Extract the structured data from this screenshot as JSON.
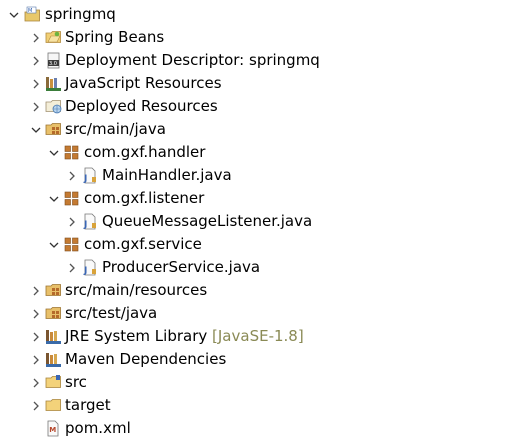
{
  "tree": {
    "project": {
      "label": "springmq",
      "icon": "maven-project-icon"
    },
    "items": [
      {
        "label": "Spring Beans",
        "icon": "spring-beans-folder-icon"
      },
      {
        "label": "Deployment Descriptor: springmq",
        "icon": "deployment-descriptor-icon"
      },
      {
        "label": "JavaScript Resources",
        "icon": "javascript-resources-icon"
      },
      {
        "label": "Deployed Resources",
        "icon": "deployed-resources-icon"
      },
      {
        "label": "src/main/java",
        "icon": "source-folder-icon"
      },
      {
        "label": "com.gxf.handler",
        "icon": "package-icon"
      },
      {
        "label": "MainHandler.java",
        "icon": "java-file-icon"
      },
      {
        "label": "com.gxf.listener",
        "icon": "package-icon"
      },
      {
        "label": "QueueMessageListener.java",
        "icon": "java-file-icon"
      },
      {
        "label": "com.gxf.service",
        "icon": "package-icon"
      },
      {
        "label": "ProducerService.java",
        "icon": "java-file-icon"
      },
      {
        "label": "src/main/resources",
        "icon": "source-folder-icon"
      },
      {
        "label": "src/test/java",
        "icon": "source-folder-icon"
      },
      {
        "label": "JRE System Library",
        "decoration": "[JavaSE-1.8]",
        "icon": "library-icon"
      },
      {
        "label": "Maven Dependencies",
        "icon": "library-icon"
      },
      {
        "label": "src",
        "icon": "folder-icon"
      },
      {
        "label": "target",
        "icon": "folder-icon"
      },
      {
        "label": "pom.xml",
        "icon": "xml-file-icon"
      }
    ]
  }
}
